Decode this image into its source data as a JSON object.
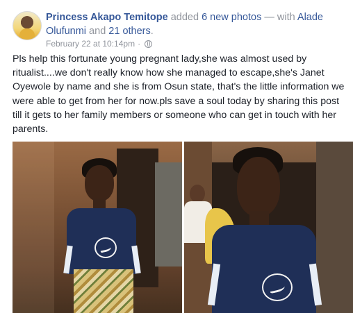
{
  "post": {
    "author_name": "Princess Akapo Temitope",
    "action_text": " added ",
    "photo_count_text": "6 new photos",
    "with_text": " — with ",
    "tagged_person": "Alade Olufunmi",
    "and_text": " and ",
    "others_text": "21 others",
    "period": ".",
    "timestamp": "February 22 at 10:14pm",
    "separator": "·",
    "privacy_icon": "globe-icon",
    "body": "Pls help this fortunate young pregnant lady,she was almost used by ritualist....we don't really know how she managed to escape,she's Janet Oyewole by name and she is from Osun state, that's the little information we were able to get from her for now.pls save a soul today by sharing this post till it gets to her family members or someone who can get in touch with her parents."
  },
  "colors": {
    "link": "#365899",
    "meta": "#90949c",
    "text": "#1d2129",
    "jersey": "#1f2f57"
  },
  "photos": [
    {
      "name": "photo-left",
      "icon": "photo"
    },
    {
      "name": "photo-right",
      "icon": "photo"
    }
  ]
}
